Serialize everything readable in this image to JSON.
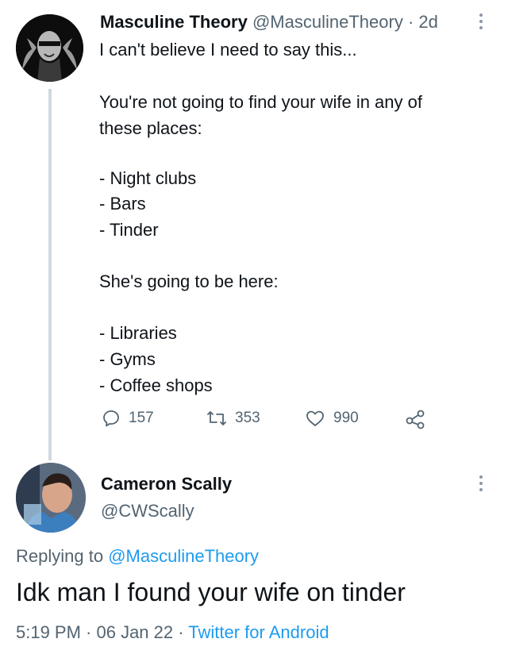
{
  "tweet": {
    "author_name": "Masculine Theory",
    "author_handle": "@MasculineTheory",
    "separator": "·",
    "time_ago": "2d",
    "lines": [
      "I can't believe I need to say this...",
      "You're not going to find your wife in any of",
      "these places:",
      "- Night clubs",
      "- Bars",
      "- Tinder",
      "She's going to be here:",
      "- Libraries",
      "- Gyms",
      "- Coffee shops"
    ],
    "stats": {
      "replies": "157",
      "retweets": "353",
      "likes": "990"
    }
  },
  "reply": {
    "author_name": "Cameron Scally",
    "author_handle": "@CWScally",
    "replying_prefix": "Replying to",
    "replying_handle": "@MasculineTheory",
    "text": "Idk man I found your wife on tinder",
    "timestamp": "5:19 PM · 06 Jan 22 ·",
    "source": "Twitter for Android"
  },
  "colors": {
    "text": "#0f1419",
    "muted": "#536471",
    "link": "#1d9bf0",
    "thread_line": "#cfd9de"
  },
  "icons": [
    "reply-icon",
    "retweet-icon",
    "like-icon",
    "share-icon",
    "more-icon"
  ]
}
